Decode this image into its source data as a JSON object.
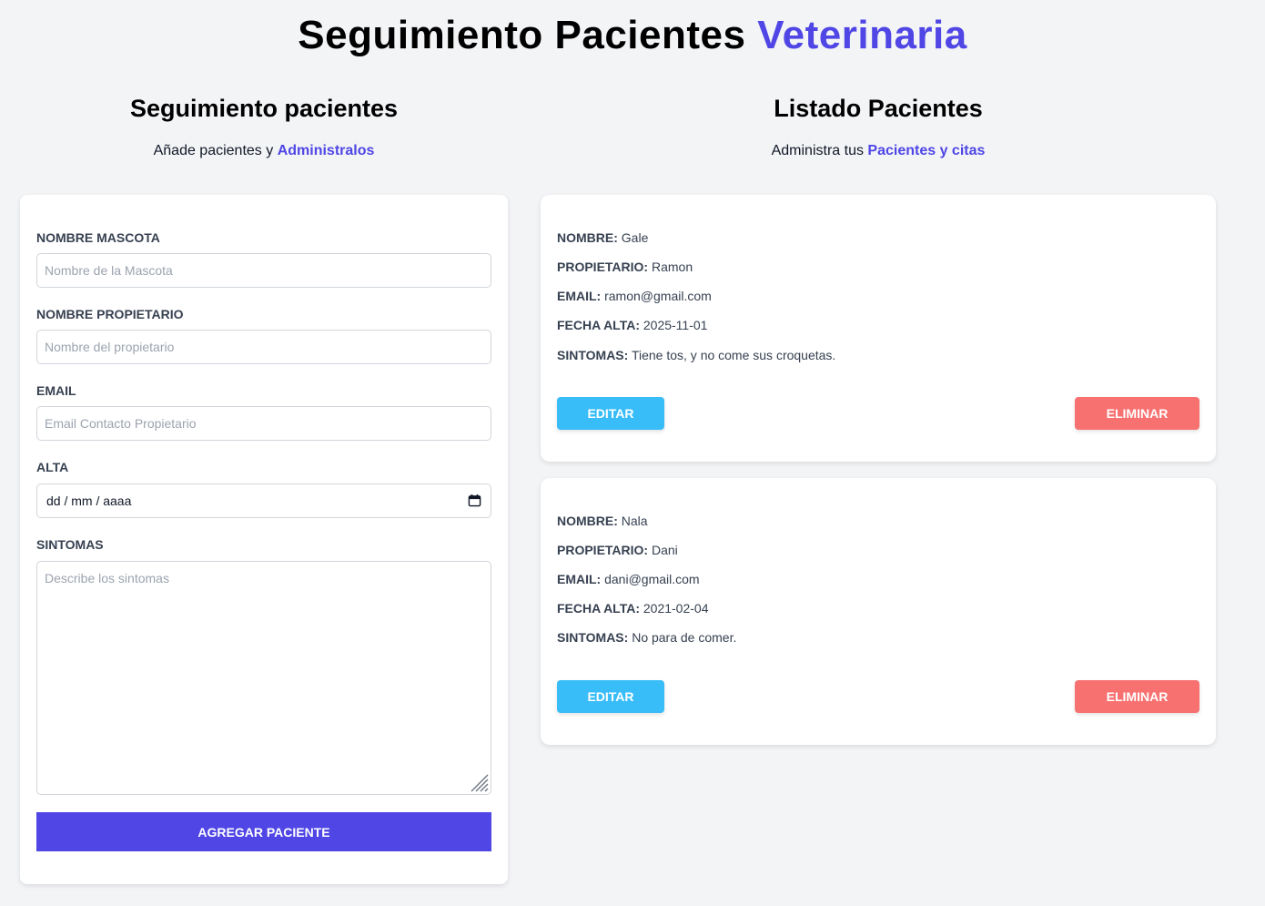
{
  "header": {
    "title_main": "Seguimiento Pacientes",
    "title_accent": "Veterinaria"
  },
  "form_section": {
    "title": "Seguimiento pacientes",
    "subtitle_text": "Añade pacientes y",
    "subtitle_accent": "Administralos",
    "fields": {
      "pet_label": "Nombre Mascota",
      "pet_placeholder": "Nombre de la Mascota",
      "owner_label": "Nombre Propietario",
      "owner_placeholder": "Nombre del propietario",
      "email_label": "Email",
      "email_placeholder": "Email Contacto Propietario",
      "date_label": "Alta",
      "date_placeholder": "dd / mm / aaaa",
      "symptoms_label": "Sintomas",
      "symptoms_placeholder": "Describe los sintomas"
    },
    "submit_label": "Agregar Paciente"
  },
  "list_section": {
    "title": "Listado Pacientes",
    "subtitle_text": "Administra tus",
    "subtitle_accent": "Pacientes y citas",
    "field_keys": {
      "name": "Nombre:",
      "owner": "Propietario:",
      "email": "Email:",
      "date": "Fecha Alta:",
      "symptoms": "Sintomas:"
    },
    "patients": [
      {
        "name": "Gale",
        "owner": "Ramon",
        "email": "ramon@gmail.com",
        "date": "2025-11-01",
        "symptoms": "Tiene tos, y no come sus croquetas."
      },
      {
        "name": "Nala",
        "owner": "Dani",
        "email": "dani@gmail.com",
        "date": "2021-02-04",
        "symptoms": "No para de comer."
      }
    ],
    "edit_label": "Editar",
    "delete_label": "Eliminar"
  },
  "colors": {
    "accent": "#4f46e5",
    "edit": "#38bdf8",
    "delete": "#f87171",
    "background": "#f3f4f6"
  }
}
